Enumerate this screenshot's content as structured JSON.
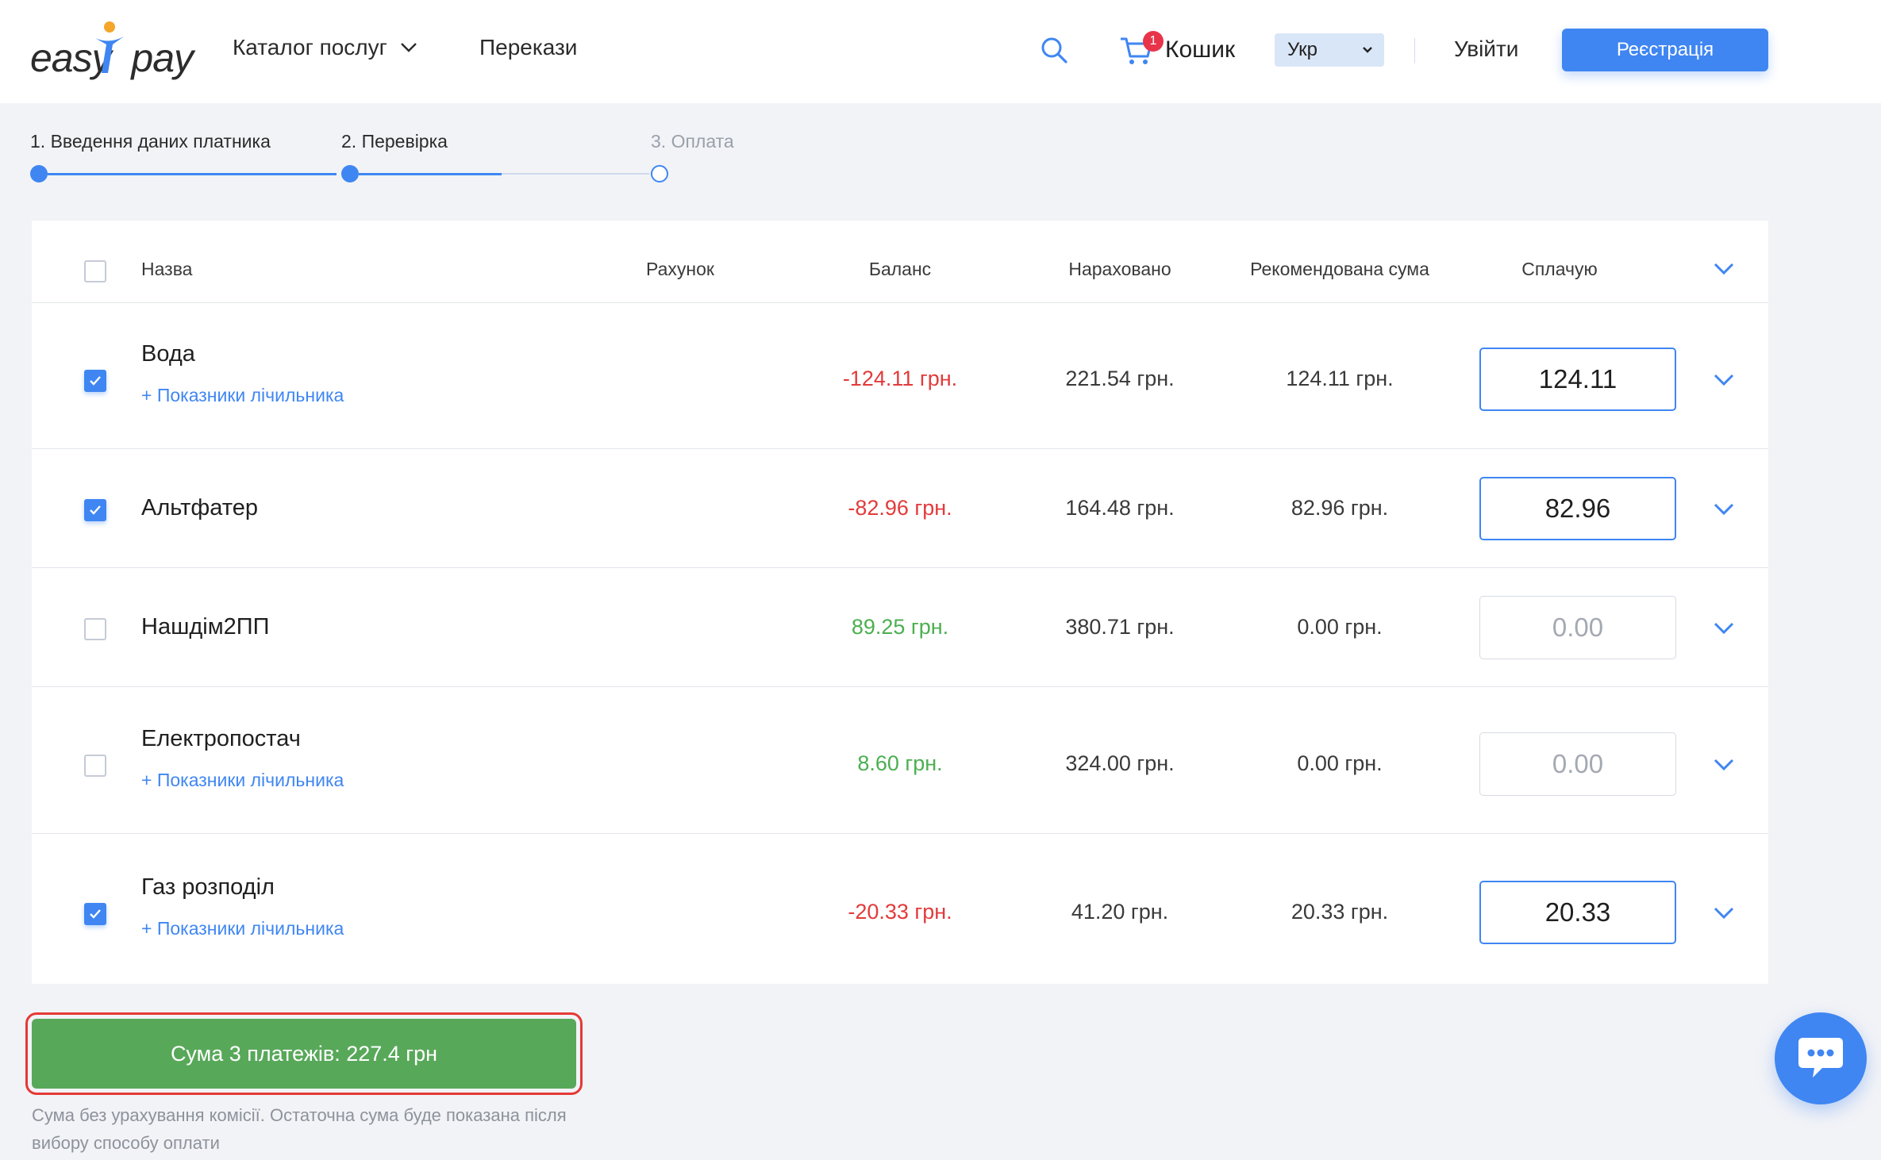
{
  "header": {
    "logo": "easypay",
    "nav": {
      "catalog": "Каталог послуг",
      "transfers": "Перекази"
    },
    "cart": {
      "label": "Кошик",
      "badge": "1"
    },
    "language": "Укр",
    "login": "Увійти",
    "register": "Реєстрація"
  },
  "stepper": {
    "steps": [
      {
        "label": "1. Введення даних платника",
        "state": "done"
      },
      {
        "label": "2. Перевірка",
        "state": "current"
      },
      {
        "label": "3. Оплата",
        "state": "todo"
      }
    ]
  },
  "table": {
    "columns": {
      "name": "Назва",
      "account": "Рахунок",
      "balance": "Баланс",
      "accrued": "Нараховано",
      "recommended": "Рекомендована сума",
      "paying": "Сплачую"
    },
    "meter_link": "+ Показники лічильника",
    "rows": [
      {
        "name": "Вода",
        "checked": true,
        "has_meter": true,
        "balance": "-124.11 грн.",
        "balance_sign": "neg",
        "accrued": "221.54 грн.",
        "recommended": "124.11 грн.",
        "paying": "124.11"
      },
      {
        "name": "Альтфатер",
        "checked": true,
        "has_meter": false,
        "balance": "-82.96 грн.",
        "balance_sign": "neg",
        "accrued": "164.48 грн.",
        "recommended": "82.96 грн.",
        "paying": "82.96"
      },
      {
        "name": "Нашдім2ПП",
        "checked": false,
        "has_meter": false,
        "balance": "89.25 грн.",
        "balance_sign": "pos",
        "accrued": "380.71 грн.",
        "recommended": "0.00 грн.",
        "paying": "0.00"
      },
      {
        "name": "Електропостач",
        "checked": false,
        "has_meter": true,
        "balance": "8.60 грн.",
        "balance_sign": "pos",
        "accrued": "324.00 грн.",
        "recommended": "0.00 грн.",
        "paying": "0.00"
      },
      {
        "name": "Газ розподіл",
        "checked": true,
        "has_meter": true,
        "balance": "-20.33 грн.",
        "balance_sign": "neg",
        "accrued": "41.20 грн.",
        "recommended": "20.33 грн.",
        "paying": "20.33"
      }
    ]
  },
  "summary": {
    "button": "Сума 3 платежів: 227.4 грн",
    "note": "Сума без урахування комісії. Остаточна сума буде показана після вибору способу оплати"
  },
  "colors": {
    "accent": "#3f86f2",
    "negative": "#e23b3b",
    "positive": "#4caf50",
    "sum_button": "#58a85a",
    "highlight_frame": "#e53935"
  }
}
